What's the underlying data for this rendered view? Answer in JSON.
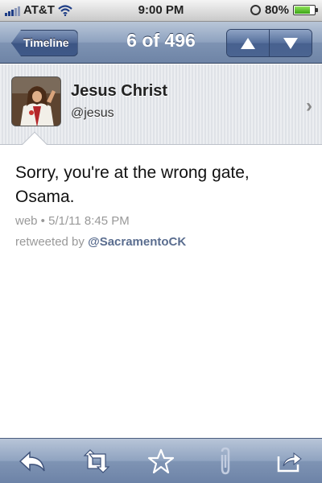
{
  "status_bar": {
    "carrier": "AT&T",
    "time": "9:00 PM",
    "battery": "80%",
    "battery_level": 0.8
  },
  "nav": {
    "back_label": "Timeline",
    "title": "6 of 496"
  },
  "profile": {
    "name": "Jesus Christ",
    "handle": "@jesus"
  },
  "tweet": {
    "text": "Sorry, you're at the wrong gate, Osama.",
    "meta": "web • 5/1/11 8:45 PM",
    "retweet_prefix": "retweeted by",
    "retweet_user": "@SacramentoCK"
  },
  "toolbar": {
    "icons": [
      "reply-icon",
      "retweet-icon",
      "star-icon",
      "paperclip-icon",
      "share-icon"
    ]
  },
  "colors": {
    "link": "#5a6d8f",
    "meta": "#999999",
    "nav_blue": "#6e84a6"
  }
}
